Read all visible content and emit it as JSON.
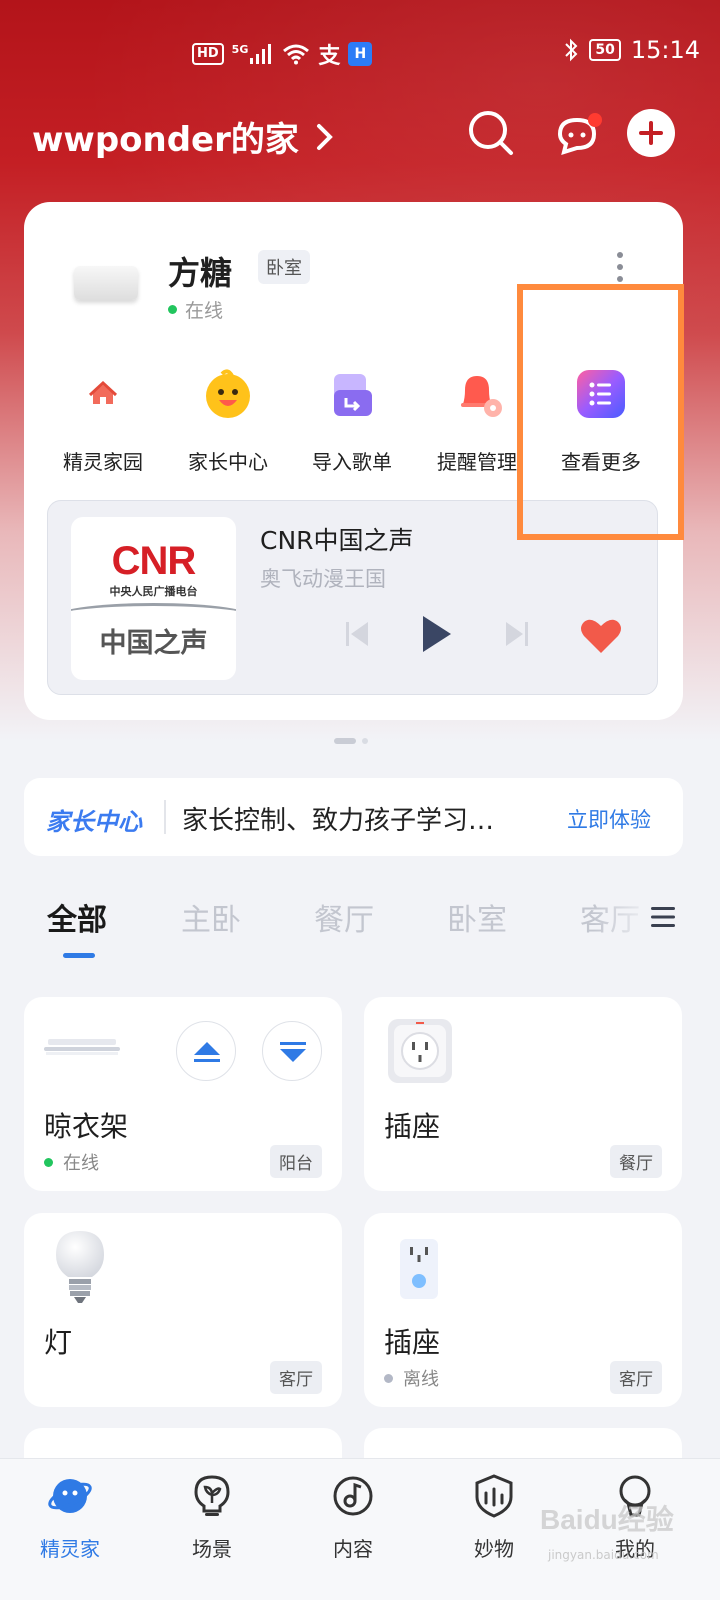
{
  "status_bar": {
    "hd": "HD",
    "network": "5G",
    "battery": "50",
    "time": "15:14"
  },
  "header": {
    "title": "wwponder的家"
  },
  "device": {
    "name": "方糖",
    "room": "卧室",
    "status": "在线"
  },
  "shortcuts": [
    {
      "label": "精灵家园"
    },
    {
      "label": "家长中心"
    },
    {
      "label": "导入歌单"
    },
    {
      "label": "提醒管理"
    },
    {
      "label": "查看更多"
    }
  ],
  "player": {
    "cover_logo": "CNR",
    "cover_sub": "中央人民广播电台",
    "cover_main": "中国之声",
    "title": "CNR中国之声",
    "artist": "奥飞动漫王国"
  },
  "banner": {
    "logo": "家长中心",
    "text": "家长控制、致力孩子学习…",
    "cta": "立即体验"
  },
  "room_tabs": [
    {
      "label": "全部"
    },
    {
      "label": "主卧"
    },
    {
      "label": "餐厅"
    },
    {
      "label": "卧室"
    },
    {
      "label": "客厅"
    }
  ],
  "devices": [
    {
      "name": "晾衣架",
      "status": "在线",
      "room": "阳台"
    },
    {
      "name": "插座",
      "status": "",
      "room": "餐厅"
    },
    {
      "name": "灯",
      "status": "",
      "room": "客厅"
    },
    {
      "name": "插座",
      "status": "离线",
      "room": "客厅"
    }
  ],
  "bottom_nav": [
    {
      "label": "精灵家"
    },
    {
      "label": "场景"
    },
    {
      "label": "内容"
    },
    {
      "label": "妙物"
    },
    {
      "label": "我的"
    }
  ],
  "watermark": {
    "brand": "Baidu经验",
    "url": "jingyan.baidu.com"
  },
  "colors": {
    "brand_red": "#c41f24",
    "accent_blue": "#2f7ae5",
    "highlight_orange": "#ff8a3d",
    "online_green": "#22c55e"
  }
}
